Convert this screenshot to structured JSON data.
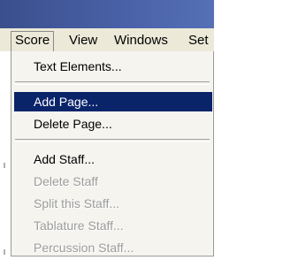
{
  "menubar": {
    "items": [
      {
        "label": "Score"
      },
      {
        "label": "View"
      },
      {
        "label": "Windows"
      },
      {
        "label": "Set"
      }
    ]
  },
  "dropdown": {
    "items": [
      {
        "label": "Text Elements...",
        "enabled": true,
        "selected": false
      },
      {
        "label": "Add Page...",
        "enabled": true,
        "selected": true
      },
      {
        "label": "Delete Page...",
        "enabled": true,
        "selected": false
      },
      {
        "label": "Add Staff...",
        "enabled": true,
        "selected": false
      },
      {
        "label": "Delete Staff",
        "enabled": false,
        "selected": false
      },
      {
        "label": "Split this Staff...",
        "enabled": false,
        "selected": false
      },
      {
        "label": "Tablature Staff...",
        "enabled": false,
        "selected": false
      },
      {
        "label": "Percussion Staff...",
        "enabled": false,
        "selected": false
      }
    ]
  }
}
